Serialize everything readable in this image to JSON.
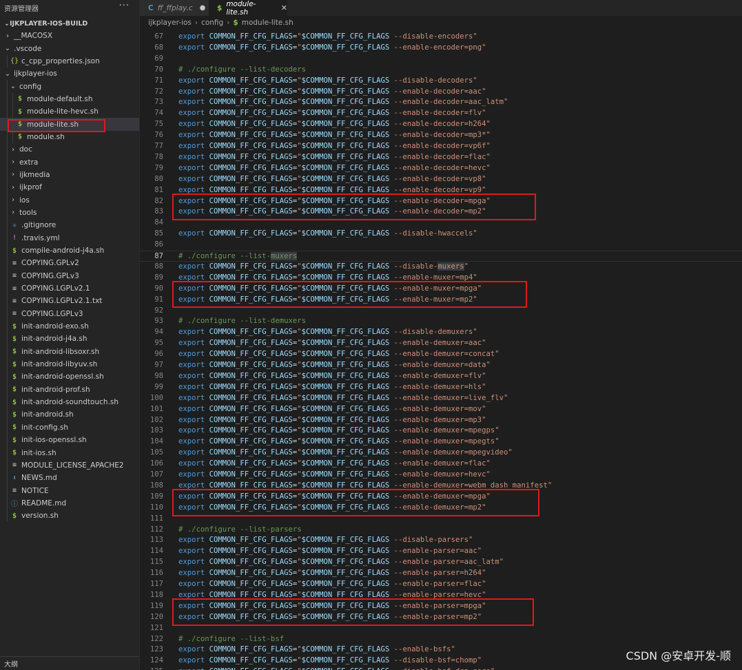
{
  "sidebar": {
    "title": "资源管理器",
    "more": "···",
    "root": "IJKPLAYER-IOS-BUILD",
    "outline_label": "大纲",
    "items": [
      {
        "label": "__MACOSX",
        "kind": "folder",
        "expanded": false,
        "depth": 0
      },
      {
        "label": ".vscode",
        "kind": "folder",
        "expanded": true,
        "depth": 0
      },
      {
        "label": "c_cpp_properties.json",
        "kind": "json",
        "icon": "{}",
        "depth": 1
      },
      {
        "label": "ijkplayer-ios",
        "kind": "folder",
        "expanded": true,
        "depth": 0
      },
      {
        "label": "config",
        "kind": "folder",
        "expanded": true,
        "depth": 1
      },
      {
        "label": "module-default.sh",
        "kind": "sh",
        "icon": "$",
        "depth": 2
      },
      {
        "label": "module-lite-hevc.sh",
        "kind": "sh",
        "icon": "$",
        "depth": 2
      },
      {
        "label": "module-lite.sh",
        "kind": "sh",
        "icon": "$",
        "depth": 2,
        "selected": true
      },
      {
        "label": "module.sh",
        "kind": "sh",
        "icon": "$",
        "depth": 2
      },
      {
        "label": "doc",
        "kind": "folder",
        "expanded": false,
        "depth": 1
      },
      {
        "label": "extra",
        "kind": "folder",
        "expanded": false,
        "depth": 1
      },
      {
        "label": "ijkmedia",
        "kind": "folder",
        "expanded": false,
        "depth": 1
      },
      {
        "label": "ijkprof",
        "kind": "folder",
        "expanded": false,
        "depth": 1
      },
      {
        "label": "ios",
        "kind": "folder",
        "expanded": false,
        "depth": 1
      },
      {
        "label": "tools",
        "kind": "folder",
        "expanded": false,
        "depth": 1
      },
      {
        "label": ".gitignore",
        "kind": "git",
        "icon": "◆",
        "depth": 1
      },
      {
        "label": ".travis.yml",
        "kind": "yml",
        "icon": "!",
        "depth": 1
      },
      {
        "label": "compile-android-j4a.sh",
        "kind": "sh",
        "icon": "$",
        "depth": 1
      },
      {
        "label": "COPYING.GPLv2",
        "kind": "txt",
        "icon": "≡",
        "depth": 1
      },
      {
        "label": "COPYING.GPLv3",
        "kind": "txt",
        "icon": "≡",
        "depth": 1
      },
      {
        "label": "COPYING.LGPLv2.1",
        "kind": "txt",
        "icon": "≡",
        "depth": 1
      },
      {
        "label": "COPYING.LGPLv2.1.txt",
        "kind": "txt",
        "icon": "≡",
        "depth": 1
      },
      {
        "label": "COPYING.LGPLv3",
        "kind": "txt",
        "icon": "≡",
        "depth": 1
      },
      {
        "label": "init-android-exo.sh",
        "kind": "sh",
        "icon": "$",
        "depth": 1
      },
      {
        "label": "init-android-j4a.sh",
        "kind": "sh",
        "icon": "$",
        "depth": 1
      },
      {
        "label": "init-android-libsoxr.sh",
        "kind": "sh",
        "icon": "$",
        "depth": 1
      },
      {
        "label": "init-android-libyuv.sh",
        "kind": "sh",
        "icon": "$",
        "depth": 1
      },
      {
        "label": "init-android-openssl.sh",
        "kind": "sh",
        "icon": "$",
        "depth": 1
      },
      {
        "label": "init-android-prof.sh",
        "kind": "sh",
        "icon": "$",
        "depth": 1
      },
      {
        "label": "init-android-soundtouch.sh",
        "kind": "sh",
        "icon": "$",
        "depth": 1
      },
      {
        "label": "init-android.sh",
        "kind": "sh",
        "icon": "$",
        "depth": 1
      },
      {
        "label": "init-config.sh",
        "kind": "sh",
        "icon": "$",
        "depth": 1
      },
      {
        "label": "init-ios-openssl.sh",
        "kind": "sh",
        "icon": "$",
        "depth": 1
      },
      {
        "label": "init-ios.sh",
        "kind": "sh",
        "icon": "$",
        "depth": 1
      },
      {
        "label": "MODULE_LICENSE_APACHE2",
        "kind": "txt",
        "icon": "≡",
        "depth": 1
      },
      {
        "label": "NEWS.md",
        "kind": "md",
        "icon": "⬇",
        "depth": 1
      },
      {
        "label": "NOTICE",
        "kind": "txt",
        "icon": "≡",
        "depth": 1
      },
      {
        "label": "README.md",
        "kind": "info",
        "icon": "ⓘ",
        "depth": 1
      },
      {
        "label": "version.sh",
        "kind": "sh",
        "icon": "$",
        "depth": 1
      }
    ]
  },
  "tabs": [
    {
      "icon": "C",
      "label": "ff_ffplay.c",
      "active": false,
      "modified_dot": "●"
    },
    {
      "icon": "$",
      "label": "module-lite.sh",
      "active": true,
      "close": "✕"
    }
  ],
  "breadcrumb": [
    {
      "label": "ijkplayer-ios"
    },
    {
      "label": "config"
    },
    {
      "label": "module-lite.sh",
      "icon": "$"
    }
  ],
  "breadcrumb_sep": "›",
  "editor": {
    "current_line": 87,
    "lines": [
      {
        "n": 67,
        "t": "flag",
        "a": "--disable-encoders"
      },
      {
        "n": 68,
        "t": "flag",
        "a": "--enable-encoder=png"
      },
      {
        "n": 69,
        "t": "blank"
      },
      {
        "n": 70,
        "t": "comment",
        "text": "# ./configure --list-decoders"
      },
      {
        "n": 71,
        "t": "flag",
        "a": "--disable-decoders"
      },
      {
        "n": 72,
        "t": "flag",
        "a": "--enable-decoder=aac"
      },
      {
        "n": 73,
        "t": "flag",
        "a": "--enable-decoder=aac_latm"
      },
      {
        "n": 74,
        "t": "flag",
        "a": "--enable-decoder=flv"
      },
      {
        "n": 75,
        "t": "flag",
        "a": "--enable-decoder=h264"
      },
      {
        "n": 76,
        "t": "flag",
        "a": "--enable-decoder=mp3*"
      },
      {
        "n": 77,
        "t": "flag",
        "a": "--enable-decoder=vp6f"
      },
      {
        "n": 78,
        "t": "flag",
        "a": "--enable-decoder=flac"
      },
      {
        "n": 79,
        "t": "flag",
        "a": "--enable-decoder=hevc"
      },
      {
        "n": 80,
        "t": "flag",
        "a": "--enable-decoder=vp8"
      },
      {
        "n": 81,
        "t": "flag",
        "a": "--enable-decoder=vp9"
      },
      {
        "n": 82,
        "t": "flag",
        "a": "--enable-decoder=mpga"
      },
      {
        "n": 83,
        "t": "flag",
        "a": "--enable-decoder=mp2"
      },
      {
        "n": 84,
        "t": "blank"
      },
      {
        "n": 85,
        "t": "flag",
        "a": "--disable-hwaccels"
      },
      {
        "n": 86,
        "t": "blank"
      },
      {
        "n": 87,
        "t": "comment",
        "text": "# ./configure --list-muxers"
      },
      {
        "n": 88,
        "t": "flag",
        "a": "--disable-muxers"
      },
      {
        "n": 89,
        "t": "flag",
        "a": "--enable-muxer=mp4"
      },
      {
        "n": 90,
        "t": "flag",
        "a": "--enable-muxer=mpga"
      },
      {
        "n": 91,
        "t": "flag",
        "a": "--enable-muxer=mp2"
      },
      {
        "n": 92,
        "t": "blank"
      },
      {
        "n": 93,
        "t": "comment",
        "text": "# ./configure --list-demuxers"
      },
      {
        "n": 94,
        "t": "flag",
        "a": "--disable-demuxers"
      },
      {
        "n": 95,
        "t": "flag",
        "a": "--enable-demuxer=aac"
      },
      {
        "n": 96,
        "t": "flag",
        "a": "--enable-demuxer=concat"
      },
      {
        "n": 97,
        "t": "flag",
        "a": "--enable-demuxer=data"
      },
      {
        "n": 98,
        "t": "flag",
        "a": "--enable-demuxer=flv"
      },
      {
        "n": 99,
        "t": "flag",
        "a": "--enable-demuxer=hls"
      },
      {
        "n": 100,
        "t": "flag",
        "a": "--enable-demuxer=live_flv"
      },
      {
        "n": 101,
        "t": "flag",
        "a": "--enable-demuxer=mov"
      },
      {
        "n": 102,
        "t": "flag",
        "a": "--enable-demuxer=mp3"
      },
      {
        "n": 103,
        "t": "flag",
        "a": "--enable-demuxer=mpegps"
      },
      {
        "n": 104,
        "t": "flag",
        "a": "--enable-demuxer=mpegts"
      },
      {
        "n": 105,
        "t": "flag",
        "a": "--enable-demuxer=mpegvideo"
      },
      {
        "n": 106,
        "t": "flag",
        "a": "--enable-demuxer=flac"
      },
      {
        "n": 107,
        "t": "flag",
        "a": "--enable-demuxer=hevc"
      },
      {
        "n": 108,
        "t": "flag",
        "a": "--enable-demuxer=webm_dash_manifest"
      },
      {
        "n": 109,
        "t": "flag",
        "a": "--enable-demuxer=mpga"
      },
      {
        "n": 110,
        "t": "flag",
        "a": "--enable-demuxer=mp2"
      },
      {
        "n": 111,
        "t": "blank"
      },
      {
        "n": 112,
        "t": "comment",
        "text": "# ./configure --list-parsers"
      },
      {
        "n": 113,
        "t": "flag",
        "a": "--disable-parsers"
      },
      {
        "n": 114,
        "t": "flag",
        "a": "--enable-parser=aac"
      },
      {
        "n": 115,
        "t": "flag",
        "a": "--enable-parser=aac_latm"
      },
      {
        "n": 116,
        "t": "flag",
        "a": "--enable-parser=h264"
      },
      {
        "n": 117,
        "t": "flag",
        "a": "--enable-parser=flac"
      },
      {
        "n": 118,
        "t": "flag",
        "a": "--enable-parser=hevc"
      },
      {
        "n": 119,
        "t": "flag",
        "a": "--enable-parser=mpga"
      },
      {
        "n": 120,
        "t": "flag",
        "a": "--enable-parser=mp2"
      },
      {
        "n": 121,
        "t": "blank"
      },
      {
        "n": 122,
        "t": "comment",
        "text": "# ./configure --list-bsf"
      },
      {
        "n": 123,
        "t": "flag",
        "a": "--enable-bsfs"
      },
      {
        "n": 124,
        "t": "flag",
        "a": "--disable-bsf=chomp"
      },
      {
        "n": 125,
        "t": "flag",
        "a": "--disable-bsf=dca_core"
      }
    ],
    "tokens": {
      "keyword": "export",
      "var": "COMMON_FF_CFG_FLAGS",
      "assign": "=",
      "ref": "$COMMON_FF_CFG_FLAGS"
    },
    "highlight_word": "muxers",
    "highlighted_ranges": [
      [
        82,
        83
      ],
      [
        90,
        91
      ],
      [
        109,
        110
      ],
      [
        119,
        120
      ]
    ]
  },
  "watermark": "CSDN @安卓开发-顺",
  "colors": {
    "editor_bg": "#1e1e1e",
    "sidebar_bg": "#252526",
    "keyword": "#569cd6",
    "variable": "#9cdcfe",
    "string": "#ce9178",
    "comment": "#6a9955",
    "annotation_red": "#e0191b",
    "sh_icon": "#8dc149"
  }
}
